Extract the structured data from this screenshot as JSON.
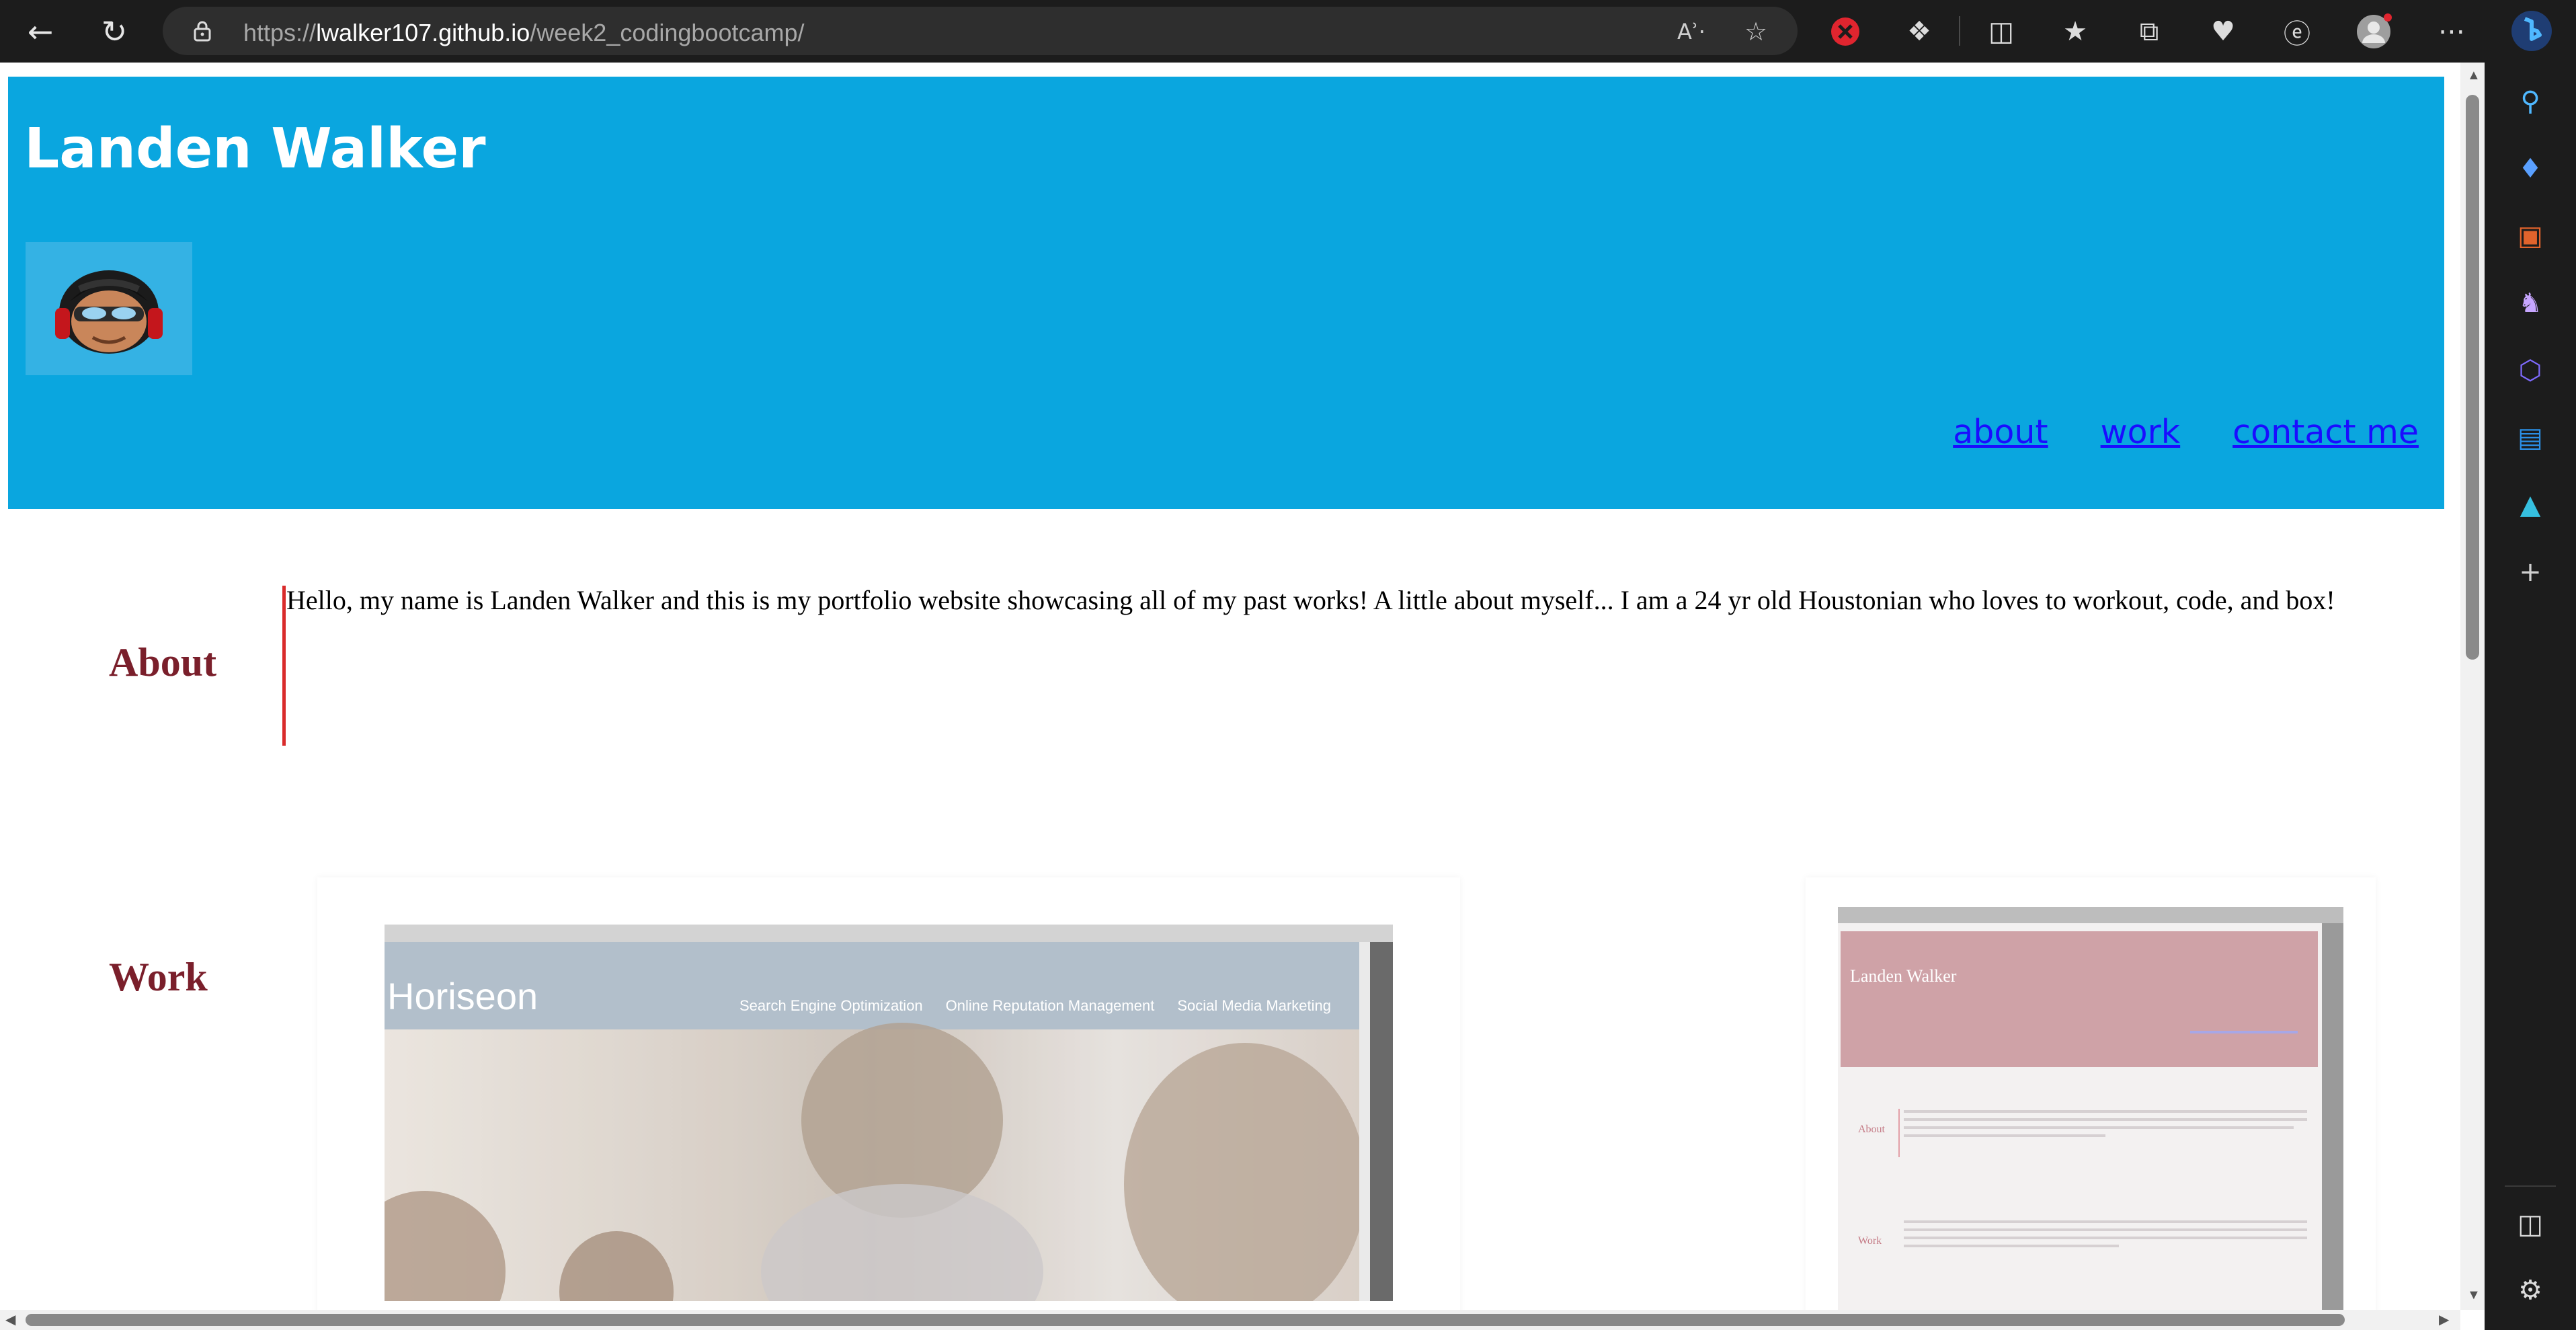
{
  "browser": {
    "url_prefix": "https://",
    "url_host": "lwalker107.github.io",
    "url_path": "/week2_codingbootcamp/",
    "read_aloud_glyph": "Aʾ·",
    "icons": [
      "back-icon",
      "refresh-icon",
      "lock-icon",
      "read-aloud-icon",
      "favorite-star-icon",
      "blocked-extension-icon",
      "extensions-icon",
      "split-screen-icon",
      "favorites-icon",
      "collections-icon",
      "browser-essentials-icon",
      "edge-drop-icon",
      "profile-icon",
      "more-icon",
      "copilot-icon"
    ]
  },
  "sidebar": {
    "icons": [
      "search-icon",
      "shopping-tag-icon",
      "tools-icon",
      "games-icon",
      "microsoft365-icon",
      "outlook-icon",
      "drop-icon",
      "add-icon",
      "sidebar-toggle-icon",
      "settings-icon"
    ]
  },
  "header": {
    "title": "Landen Walker",
    "nav": [
      "about",
      "work",
      "contact me"
    ],
    "colors": {
      "background": "#0aa6df",
      "link": "#1a0dff"
    }
  },
  "about": {
    "heading": "About",
    "text": "Hello, my name is Landen Walker and this is my portfolio website showcasing all of my past works! A little about myself... I am a 24 yr old Houstonian who loves to workout, code, and box!"
  },
  "work": {
    "heading": "Work",
    "project1": {
      "brand": "Horiseon",
      "links": [
        "Search Engine Optimization",
        "Online Reputation Management",
        "Social Media Marketing"
      ]
    },
    "project2": {
      "title": "Landen Walker",
      "about_label": "About",
      "work_label": "Work"
    }
  }
}
